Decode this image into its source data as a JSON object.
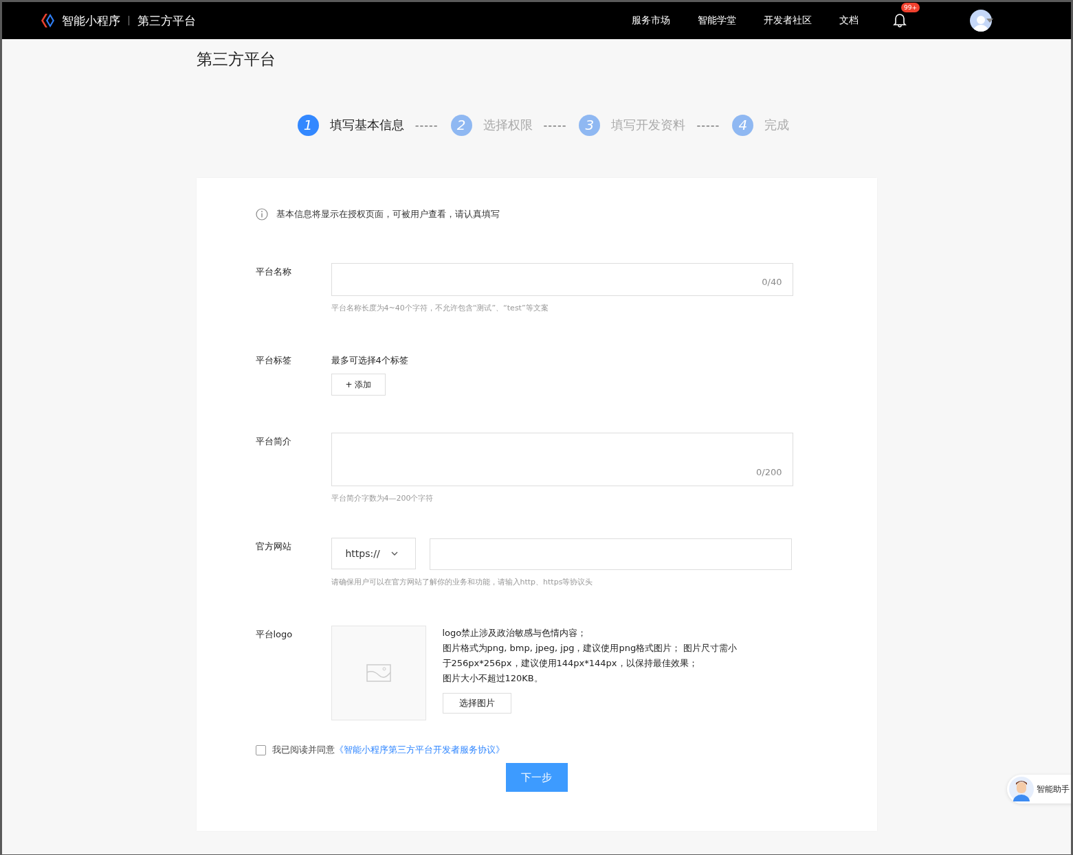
{
  "header": {
    "brand": "智能小程序",
    "product": "第三方平台",
    "nav": [
      "服务市场",
      "智能学堂",
      "开发者社区",
      "文档"
    ],
    "notification_badge": "99+"
  },
  "page_title": "第三方平台",
  "steps": [
    {
      "number": "1",
      "label": "填写基本信息",
      "selected": true,
      "dashes": "-----"
    },
    {
      "number": "2",
      "label": "选择权限",
      "selected": false,
      "dashes": "-----"
    },
    {
      "number": "3",
      "label": "填写开发资料",
      "selected": false,
      "dashes": "-----"
    },
    {
      "number": "4",
      "label": "完成",
      "selected": false
    }
  ],
  "notice": "基本信息将显示在授权页面，可被用户查看，请认真填写",
  "name_field": {
    "label": "平台名称",
    "counter": "0/40",
    "hint": "平台名称长度为4~40个字符，不允许包含“测试”、“test”等文案"
  },
  "tags_field": {
    "label": "平台标签",
    "note": "最多可选择4个标签",
    "add_button": "+ 添加"
  },
  "intro_field": {
    "label": "平台简介",
    "counter": "0/200",
    "hint": "平台简介字数为4—200个字符"
  },
  "website_field": {
    "label": "官方网站",
    "protocol": "https://",
    "hint": "请确保用户可以在官方网站了解你的业务和功能，请输入http、https等协议头"
  },
  "logo_field": {
    "label": "平台logo",
    "rules": [
      "logo禁止涉及政治敏感与色情内容；",
      "图片格式为png, bmp, jpeg, jpg，建议使用png格式图片；  图片尺寸需小",
      "于256px*256px，建议使用144px*144px，以保持最佳效果；",
      "图片大小不超过120KB。"
    ],
    "choose_button": "选择图片"
  },
  "agreement": {
    "checked": false,
    "text": "我已阅读并同意",
    "link": "《智能小程序第三方平台开发者服务协议》"
  },
  "next_button": "下一步",
  "assistant": {
    "label": "智能助手"
  }
}
